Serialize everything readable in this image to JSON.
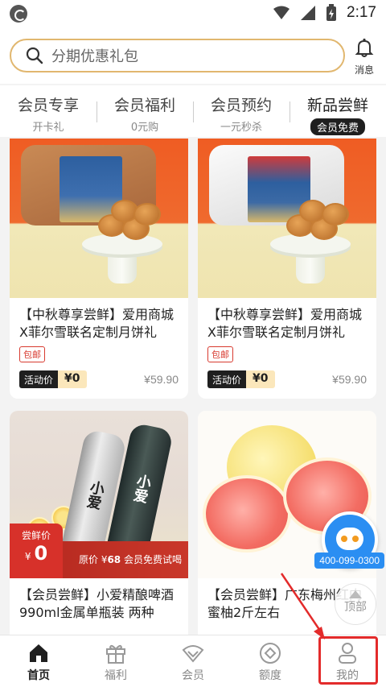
{
  "status_bar": {
    "time": "2:17"
  },
  "search": {
    "placeholder": "分期优惠礼包"
  },
  "header": {
    "message_label": "消息"
  },
  "category_tabs": [
    {
      "title": "会员专享",
      "subtitle": "开卡礼"
    },
    {
      "title": "会员福利",
      "subtitle": "0元购"
    },
    {
      "title": "会员预约",
      "subtitle": "一元秒杀"
    },
    {
      "title": "新品尝鲜",
      "subtitle": "会员免费",
      "active": true
    }
  ],
  "products": [
    {
      "title": "【中秋尊享尝鲜】爱用商城X菲尔雪联名定制月饼礼盒...",
      "tag": "包邮",
      "activity_label": "活动价",
      "activity_price": "¥0",
      "original_price": "¥59.90"
    },
    {
      "title": "【中秋尊享尝鲜】爱用商城X菲尔雪联名定制月饼礼盒...",
      "tag": "包邮",
      "activity_label": "活动价",
      "activity_price": "¥0",
      "original_price": "¥59.90"
    },
    {
      "title": "【会员尝鲜】小爱精酿啤酒990ml金属单瓶装 两种口...",
      "banner_label": "尝鲜价",
      "banner_currency": "¥",
      "banner_price": "0",
      "banner_note_prefix": "原价 ¥",
      "banner_note_price": "68",
      "banner_note_suffix": "会员免费试喝",
      "bottle_text_1": "小爱",
      "bottle_text_2": "小爱"
    },
    {
      "title": "【会员尝鲜】广东梅州红肉蜜柚2斤左右"
    }
  ],
  "float": {
    "hotline": "400-099-0300",
    "top_label": "顶部"
  },
  "bottom_nav": [
    {
      "label": "首页",
      "icon": "home-icon",
      "active": true
    },
    {
      "label": "福利",
      "icon": "gift-icon"
    },
    {
      "label": "会员",
      "icon": "diamond-icon"
    },
    {
      "label": "额度",
      "icon": "quota-icon"
    },
    {
      "label": "我的",
      "icon": "profile-icon"
    }
  ],
  "colors": {
    "accent_gold": "#e1b76f",
    "highlight_red": "#e32b2b",
    "price_badge": "#fbe7bb"
  }
}
